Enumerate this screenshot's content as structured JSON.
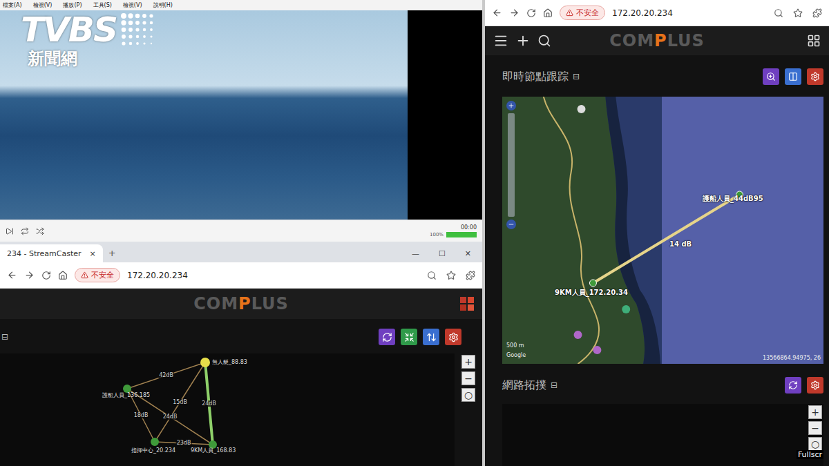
{
  "player": {
    "menu": [
      "檔案(A)",
      "檢視(V)",
      "播放(P)",
      "工具(S)",
      "檢視(V)",
      "說明(H)"
    ],
    "time": "00:00",
    "volume": {
      "label": "100%",
      "level": 1
    }
  },
  "watermark": {
    "brand": "TVBS",
    "sub": "新聞網"
  },
  "left_browser": {
    "tabs": [
      {
        "label": "234 - StreamCaster",
        "selected": true
      }
    ],
    "tab_close": "×",
    "new_tab": "+",
    "window_controls": [
      "—",
      "☐",
      "✕"
    ],
    "security": "不安全",
    "url": "172.20.20.234",
    "logo": [
      {
        "text": "COM",
        "accent": false
      },
      {
        "text": "P",
        "accent": true
      },
      {
        "text": "LUS",
        "accent": false
      }
    ],
    "section_icon": "⊟",
    "toolbar": [
      {
        "color": "#6f3fc0"
      },
      {
        "color": "#2f9a4a"
      },
      {
        "color": "#3a6fd0"
      },
      {
        "color": "#c0392b"
      }
    ],
    "topology": {
      "nodes": [
        {
          "label": "無人艇_88.83",
          "color": "#e8e04a"
        },
        {
          "label": "護船人員_136.185",
          "color": "#3f9a3a"
        },
        {
          "label": "指揮中心_20.234",
          "color": "#3f9a3a"
        },
        {
          "label": "9KM人員_168.83",
          "color": "#3f9a3a"
        }
      ],
      "edges": [
        {
          "from": 0,
          "to": 1,
          "label": "42dB",
          "strong": false
        },
        {
          "from": 0,
          "to": 2,
          "label": "15dB",
          "strong": false
        },
        {
          "from": 0,
          "to": 3,
          "label": "24dB",
          "strong": true
        },
        {
          "from": 1,
          "to": 2,
          "label": "18dB",
          "strong": false
        },
        {
          "from": 1,
          "to": 3,
          "label": "24dB",
          "strong": false
        },
        {
          "from": 2,
          "to": 3,
          "label": "23dB",
          "strong": false
        }
      ]
    },
    "zoom": [
      "+",
      "−",
      "○"
    ]
  },
  "right_browser": {
    "security": "不安全",
    "url": "172.20.20.234",
    "logo": [
      {
        "text": "COM",
        "accent": false
      },
      {
        "text": "P",
        "accent": true
      },
      {
        "text": "LUS",
        "accent": false
      }
    ],
    "tracking": {
      "title": "即時節點跟踪",
      "icon": "⊟",
      "buttons": [
        {
          "color": "#6f3fc0"
        },
        {
          "color": "#3a6fd0"
        },
        {
          "color": "#c0392b"
        }
      ],
      "map": {
        "nodes": [
          {
            "label": "護船人員_44dB95"
          },
          {
            "label": "9KM人員_172.20.34"
          }
        ],
        "link": "14 dB",
        "scale": "500 m",
        "attribution": "Google",
        "coords": "13566864.94975, 26"
      }
    },
    "topology": {
      "title": "網路拓撲",
      "icon": "⊟",
      "buttons": [
        {
          "color": "#6f3fc0"
        },
        {
          "color": "#c0392b"
        }
      ],
      "zoom": [
        "+",
        "−",
        "○"
      ],
      "fullscreen": "Fullscr"
    }
  }
}
